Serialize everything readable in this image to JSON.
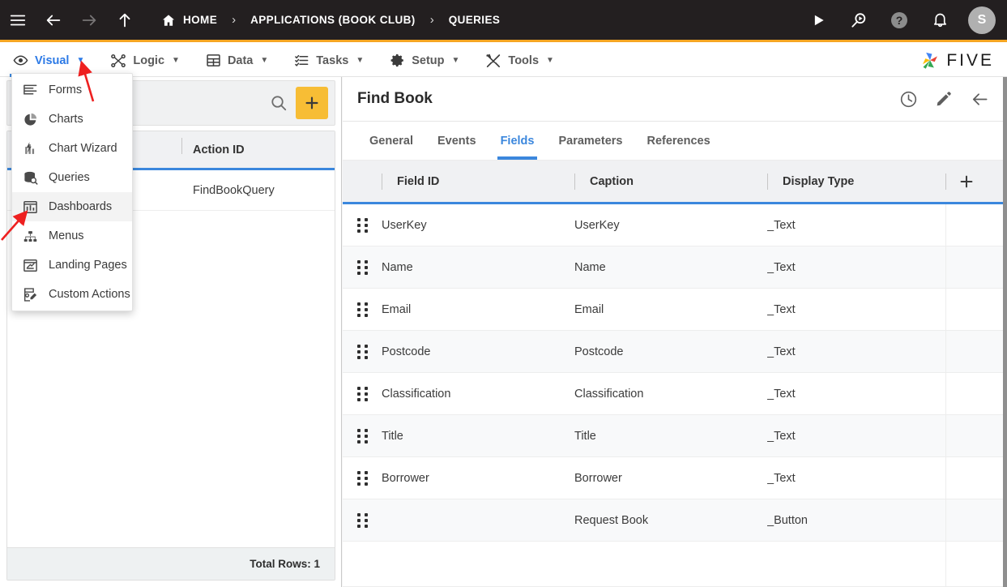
{
  "topbar": {
    "menu_icon": "hamburger-icon",
    "back_icon": "arrow-left-icon",
    "forward_icon": "arrow-right-icon",
    "up_icon": "arrow-up-icon",
    "breadcrumbs": [
      {
        "label": "HOME",
        "icon": "home-icon"
      },
      {
        "label": "APPLICATIONS (BOOK CLUB)",
        "icon": ""
      },
      {
        "label": "QUERIES",
        "icon": ""
      }
    ],
    "separator": "›",
    "actions": [
      {
        "name": "run-button",
        "icon": "play-icon"
      },
      {
        "name": "search-run-button",
        "icon": "search-play-icon"
      },
      {
        "name": "help-button",
        "icon": "help-icon"
      },
      {
        "name": "notifications-button",
        "icon": "bell-icon"
      }
    ],
    "avatar_initial": "S",
    "accent_bar_color": "#f5a623",
    "background_color": "#231f20"
  },
  "navbar": {
    "items": [
      {
        "label": "Visual",
        "icon": "eye-icon",
        "caret": "▼",
        "active": true
      },
      {
        "label": "Logic",
        "icon": "logic-nodes-icon",
        "caret": "▼",
        "active": false
      },
      {
        "label": "Data",
        "icon": "table-grid-icon",
        "caret": "▼",
        "active": false
      },
      {
        "label": "Tasks",
        "icon": "checklist-icon",
        "caret": "▼",
        "active": false
      },
      {
        "label": "Setup",
        "icon": "gear-icon",
        "caret": "▼",
        "active": false
      },
      {
        "label": "Tools",
        "icon": "tools-icon",
        "caret": "▼",
        "active": false
      }
    ],
    "brand": {
      "text": "FIVE",
      "logo_icon": "five-pinwheel-logo"
    },
    "active_color": "#2d7ae6",
    "underline_color": "#3b87dd"
  },
  "visual_menu": {
    "items": [
      {
        "label": "Forms",
        "icon": "forms-lines-icon",
        "highlighted": false
      },
      {
        "label": "Charts",
        "icon": "pie-chart-icon",
        "highlighted": false
      },
      {
        "label": "Chart Wizard",
        "icon": "chart-wizard-icon",
        "highlighted": false
      },
      {
        "label": "Queries",
        "icon": "database-search-icon",
        "highlighted": false
      },
      {
        "label": "Dashboards",
        "icon": "dashboard-icon",
        "highlighted": true
      },
      {
        "label": "Menus",
        "icon": "menu-tree-icon",
        "highlighted": false
      },
      {
        "label": "Landing Pages",
        "icon": "landing-page-icon",
        "highlighted": false
      },
      {
        "label": "Custom Actions",
        "icon": "custom-action-icon",
        "highlighted": false
      }
    ]
  },
  "left_pane": {
    "search": {
      "value": "",
      "placeholder": "",
      "icon": "search-icon"
    },
    "add_button": {
      "icon": "plus-icon",
      "color": "#f7bd35"
    },
    "grid": {
      "column_header": "Action ID",
      "rows": [
        {
          "action_id": "FindBookQuery"
        }
      ]
    },
    "footer": {
      "total_rows_label": "Total Rows: 1"
    }
  },
  "right_pane": {
    "title": "Find Book",
    "header_actions": [
      {
        "name": "history-button",
        "icon": "clock-icon"
      },
      {
        "name": "edit-button",
        "icon": "pencil-icon"
      },
      {
        "name": "back-button",
        "icon": "arrow-left-icon"
      }
    ],
    "tabs": [
      {
        "label": "General",
        "active": false
      },
      {
        "label": "Events",
        "active": false
      },
      {
        "label": "Fields",
        "active": true
      },
      {
        "label": "Parameters",
        "active": false
      },
      {
        "label": "References",
        "active": false
      }
    ],
    "table": {
      "columns": [
        "Field ID",
        "Caption",
        "Display Type"
      ],
      "add_column_icon": "plus-icon",
      "rows": [
        {
          "field_id": "UserKey",
          "caption": "UserKey",
          "display_type": "_Text"
        },
        {
          "field_id": "Name",
          "caption": "Name",
          "display_type": "_Text"
        },
        {
          "field_id": "Email",
          "caption": "Email",
          "display_type": "_Text"
        },
        {
          "field_id": "Postcode",
          "caption": "Postcode",
          "display_type": "_Text"
        },
        {
          "field_id": "Classification",
          "caption": "Classification",
          "display_type": "_Text"
        },
        {
          "field_id": "Title",
          "caption": "Title",
          "display_type": "_Text"
        },
        {
          "field_id": "Borrower",
          "caption": "Borrower",
          "display_type": "_Text"
        },
        {
          "field_id": "",
          "caption": "Request Book",
          "display_type": "_Button"
        }
      ]
    }
  },
  "annotations": {
    "arrow_color": "#ee2020",
    "arrows": [
      {
        "name": "arrow-to-visual-caret",
        "points_to": "Visual dropdown caret"
      },
      {
        "name": "arrow-to-dashboards",
        "points_to": "Dashboards menu item"
      }
    ]
  }
}
